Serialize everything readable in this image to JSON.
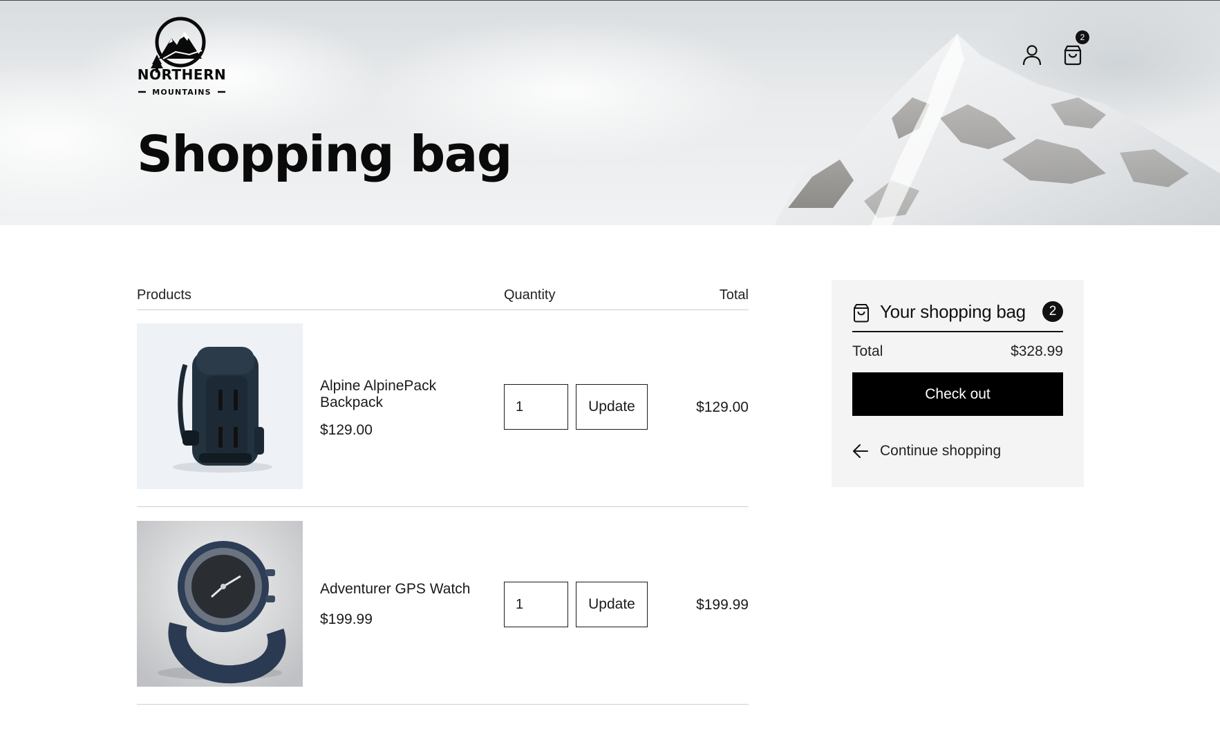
{
  "brand": {
    "name": "NORTHERN",
    "tagline": "MOUNTAINS"
  },
  "header": {
    "icons": [
      "account-icon",
      "shopping-bag-icon"
    ],
    "cart_count": "2"
  },
  "page": {
    "title": "Shopping bag"
  },
  "cart": {
    "columns": {
      "products": "Products",
      "quantity": "Quantity",
      "total": "Total"
    },
    "items": [
      {
        "name": "Alpine AlpinePack Backpack",
        "price": "$129.00",
        "quantity": "1",
        "update_label": "Update",
        "line_total": "$129.00",
        "image": "backpack-image"
      },
      {
        "name": "Adventurer GPS Watch",
        "price": "$199.99",
        "quantity": "1",
        "update_label": "Update",
        "line_total": "$199.99",
        "image": "watch-image"
      }
    ]
  },
  "summary": {
    "title": "Your shopping bag",
    "count": "2",
    "total_label": "Total",
    "total_value": "$328.99",
    "checkout_label": "Check out",
    "continue_label": "Continue shopping"
  },
  "colors": {
    "primary": "#000000",
    "summary_bg": "#f4f4f4",
    "text": "#111111"
  }
}
